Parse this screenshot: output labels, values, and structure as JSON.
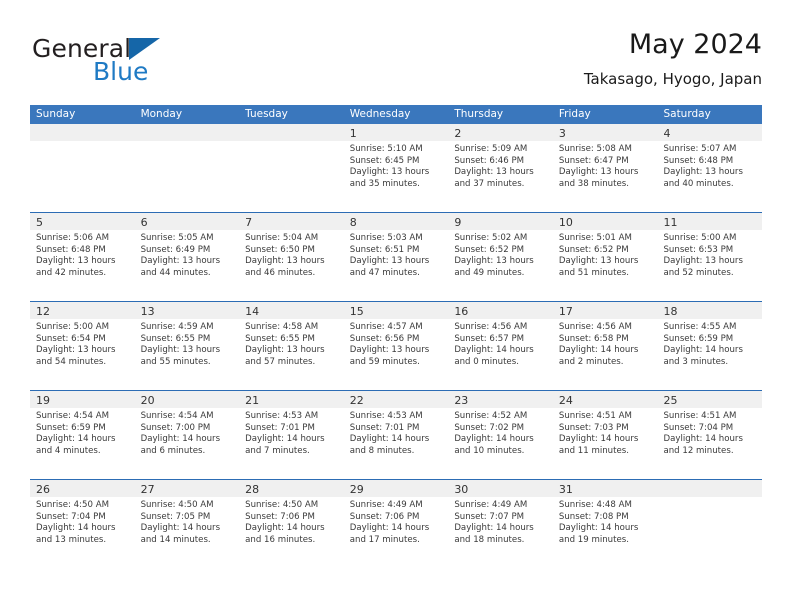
{
  "brand": {
    "name_top": "General",
    "name_bottom": "Blue",
    "triangle_icon": "brand-triangle-icon",
    "color_dark": "#231f20",
    "color_blue": "#1f7ac4"
  },
  "header": {
    "title": "May 2024",
    "subtitle": "Takasago, Hyogo, Japan"
  },
  "theme": {
    "header_blue": "#3a77bd",
    "row_border_blue": "#2c6cb4",
    "day_band_gray": "#f0f0f0",
    "text": "#3a3a3a"
  },
  "weekdays": [
    "Sunday",
    "Monday",
    "Tuesday",
    "Wednesday",
    "Thursday",
    "Friday",
    "Saturday"
  ],
  "weeks": [
    [
      {
        "day": "",
        "sunrise": "",
        "sunset": "",
        "daylight_line1": "",
        "daylight_line2": ""
      },
      {
        "day": "",
        "sunrise": "",
        "sunset": "",
        "daylight_line1": "",
        "daylight_line2": ""
      },
      {
        "day": "",
        "sunrise": "",
        "sunset": "",
        "daylight_line1": "",
        "daylight_line2": ""
      },
      {
        "day": "1",
        "sunrise": "Sunrise: 5:10 AM",
        "sunset": "Sunset: 6:45 PM",
        "daylight_line1": "Daylight: 13 hours",
        "daylight_line2": "and 35 minutes."
      },
      {
        "day": "2",
        "sunrise": "Sunrise: 5:09 AM",
        "sunset": "Sunset: 6:46 PM",
        "daylight_line1": "Daylight: 13 hours",
        "daylight_line2": "and 37 minutes."
      },
      {
        "day": "3",
        "sunrise": "Sunrise: 5:08 AM",
        "sunset": "Sunset: 6:47 PM",
        "daylight_line1": "Daylight: 13 hours",
        "daylight_line2": "and 38 minutes."
      },
      {
        "day": "4",
        "sunrise": "Sunrise: 5:07 AM",
        "sunset": "Sunset: 6:48 PM",
        "daylight_line1": "Daylight: 13 hours",
        "daylight_line2": "and 40 minutes."
      }
    ],
    [
      {
        "day": "5",
        "sunrise": "Sunrise: 5:06 AM",
        "sunset": "Sunset: 6:48 PM",
        "daylight_line1": "Daylight: 13 hours",
        "daylight_line2": "and 42 minutes."
      },
      {
        "day": "6",
        "sunrise": "Sunrise: 5:05 AM",
        "sunset": "Sunset: 6:49 PM",
        "daylight_line1": "Daylight: 13 hours",
        "daylight_line2": "and 44 minutes."
      },
      {
        "day": "7",
        "sunrise": "Sunrise: 5:04 AM",
        "sunset": "Sunset: 6:50 PM",
        "daylight_line1": "Daylight: 13 hours",
        "daylight_line2": "and 46 minutes."
      },
      {
        "day": "8",
        "sunrise": "Sunrise: 5:03 AM",
        "sunset": "Sunset: 6:51 PM",
        "daylight_line1": "Daylight: 13 hours",
        "daylight_line2": "and 47 minutes."
      },
      {
        "day": "9",
        "sunrise": "Sunrise: 5:02 AM",
        "sunset": "Sunset: 6:52 PM",
        "daylight_line1": "Daylight: 13 hours",
        "daylight_line2": "and 49 minutes."
      },
      {
        "day": "10",
        "sunrise": "Sunrise: 5:01 AM",
        "sunset": "Sunset: 6:52 PM",
        "daylight_line1": "Daylight: 13 hours",
        "daylight_line2": "and 51 minutes."
      },
      {
        "day": "11",
        "sunrise": "Sunrise: 5:00 AM",
        "sunset": "Sunset: 6:53 PM",
        "daylight_line1": "Daylight: 13 hours",
        "daylight_line2": "and 52 minutes."
      }
    ],
    [
      {
        "day": "12",
        "sunrise": "Sunrise: 5:00 AM",
        "sunset": "Sunset: 6:54 PM",
        "daylight_line1": "Daylight: 13 hours",
        "daylight_line2": "and 54 minutes."
      },
      {
        "day": "13",
        "sunrise": "Sunrise: 4:59 AM",
        "sunset": "Sunset: 6:55 PM",
        "daylight_line1": "Daylight: 13 hours",
        "daylight_line2": "and 55 minutes."
      },
      {
        "day": "14",
        "sunrise": "Sunrise: 4:58 AM",
        "sunset": "Sunset: 6:55 PM",
        "daylight_line1": "Daylight: 13 hours",
        "daylight_line2": "and 57 minutes."
      },
      {
        "day": "15",
        "sunrise": "Sunrise: 4:57 AM",
        "sunset": "Sunset: 6:56 PM",
        "daylight_line1": "Daylight: 13 hours",
        "daylight_line2": "and 59 minutes."
      },
      {
        "day": "16",
        "sunrise": "Sunrise: 4:56 AM",
        "sunset": "Sunset: 6:57 PM",
        "daylight_line1": "Daylight: 14 hours",
        "daylight_line2": "and 0 minutes."
      },
      {
        "day": "17",
        "sunrise": "Sunrise: 4:56 AM",
        "sunset": "Sunset: 6:58 PM",
        "daylight_line1": "Daylight: 14 hours",
        "daylight_line2": "and 2 minutes."
      },
      {
        "day": "18",
        "sunrise": "Sunrise: 4:55 AM",
        "sunset": "Sunset: 6:59 PM",
        "daylight_line1": "Daylight: 14 hours",
        "daylight_line2": "and 3 minutes."
      }
    ],
    [
      {
        "day": "19",
        "sunrise": "Sunrise: 4:54 AM",
        "sunset": "Sunset: 6:59 PM",
        "daylight_line1": "Daylight: 14 hours",
        "daylight_line2": "and 4 minutes."
      },
      {
        "day": "20",
        "sunrise": "Sunrise: 4:54 AM",
        "sunset": "Sunset: 7:00 PM",
        "daylight_line1": "Daylight: 14 hours",
        "daylight_line2": "and 6 minutes."
      },
      {
        "day": "21",
        "sunrise": "Sunrise: 4:53 AM",
        "sunset": "Sunset: 7:01 PM",
        "daylight_line1": "Daylight: 14 hours",
        "daylight_line2": "and 7 minutes."
      },
      {
        "day": "22",
        "sunrise": "Sunrise: 4:53 AM",
        "sunset": "Sunset: 7:01 PM",
        "daylight_line1": "Daylight: 14 hours",
        "daylight_line2": "and 8 minutes."
      },
      {
        "day": "23",
        "sunrise": "Sunrise: 4:52 AM",
        "sunset": "Sunset: 7:02 PM",
        "daylight_line1": "Daylight: 14 hours",
        "daylight_line2": "and 10 minutes."
      },
      {
        "day": "24",
        "sunrise": "Sunrise: 4:51 AM",
        "sunset": "Sunset: 7:03 PM",
        "daylight_line1": "Daylight: 14 hours",
        "daylight_line2": "and 11 minutes."
      },
      {
        "day": "25",
        "sunrise": "Sunrise: 4:51 AM",
        "sunset": "Sunset: 7:04 PM",
        "daylight_line1": "Daylight: 14 hours",
        "daylight_line2": "and 12 minutes."
      }
    ],
    [
      {
        "day": "26",
        "sunrise": "Sunrise: 4:50 AM",
        "sunset": "Sunset: 7:04 PM",
        "daylight_line1": "Daylight: 14 hours",
        "daylight_line2": "and 13 minutes."
      },
      {
        "day": "27",
        "sunrise": "Sunrise: 4:50 AM",
        "sunset": "Sunset: 7:05 PM",
        "daylight_line1": "Daylight: 14 hours",
        "daylight_line2": "and 14 minutes."
      },
      {
        "day": "28",
        "sunrise": "Sunrise: 4:50 AM",
        "sunset": "Sunset: 7:06 PM",
        "daylight_line1": "Daylight: 14 hours",
        "daylight_line2": "and 16 minutes."
      },
      {
        "day": "29",
        "sunrise": "Sunrise: 4:49 AM",
        "sunset": "Sunset: 7:06 PM",
        "daylight_line1": "Daylight: 14 hours",
        "daylight_line2": "and 17 minutes."
      },
      {
        "day": "30",
        "sunrise": "Sunrise: 4:49 AM",
        "sunset": "Sunset: 7:07 PM",
        "daylight_line1": "Daylight: 14 hours",
        "daylight_line2": "and 18 minutes."
      },
      {
        "day": "31",
        "sunrise": "Sunrise: 4:48 AM",
        "sunset": "Sunset: 7:08 PM",
        "daylight_line1": "Daylight: 14 hours",
        "daylight_line2": "and 19 minutes."
      },
      {
        "day": "",
        "sunrise": "",
        "sunset": "",
        "daylight_line1": "",
        "daylight_line2": ""
      }
    ]
  ]
}
